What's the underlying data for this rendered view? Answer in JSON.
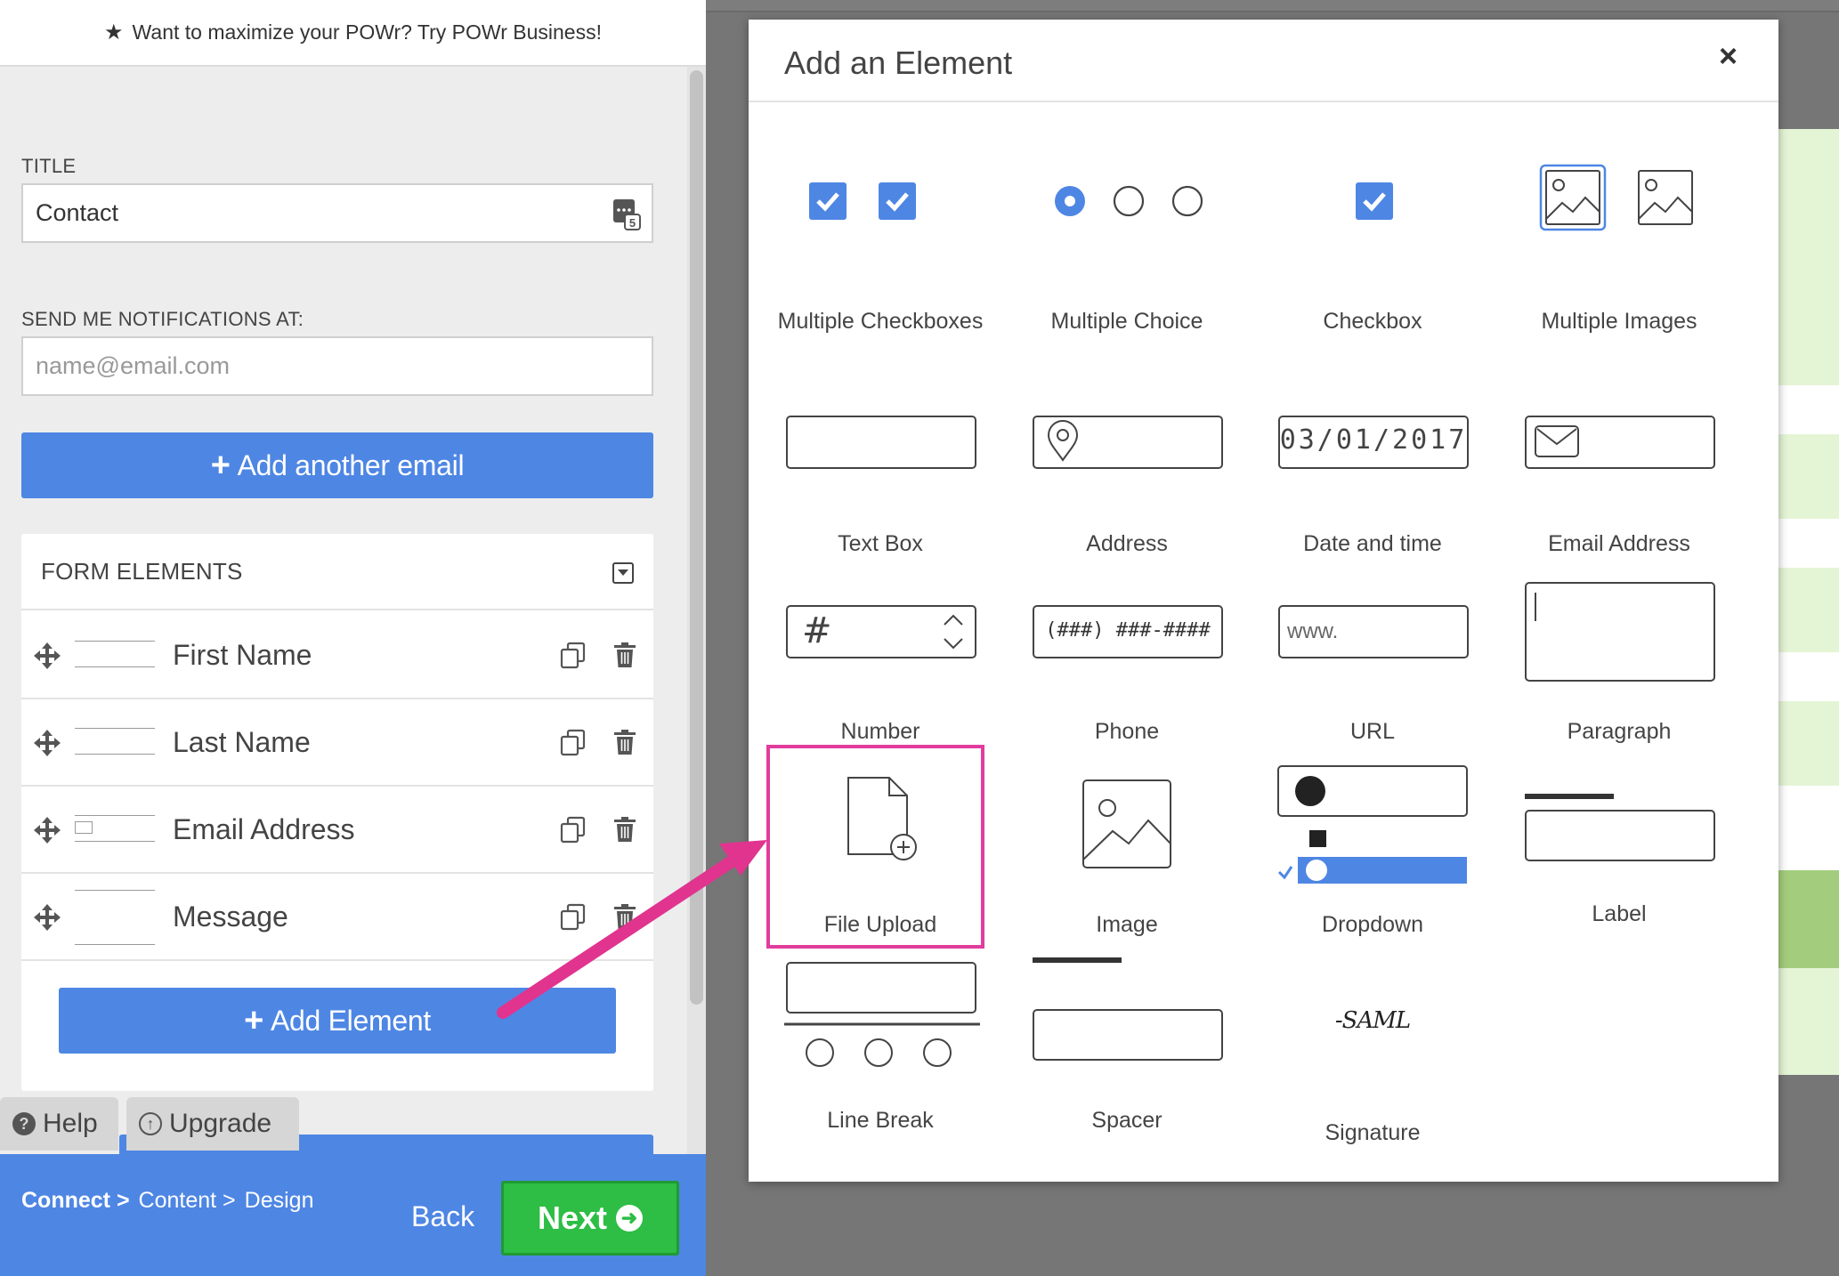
{
  "promo": {
    "text": "Want to maximize your POWr? Try POWr Business!",
    "icon": "star-icon"
  },
  "settings": {
    "title_label": "TITLE",
    "title_value": "Contact",
    "notify_label": "SEND ME NOTIFICATIONS AT:",
    "notify_placeholder": "name@email.com",
    "add_email_label": "Add another email"
  },
  "form_elements": {
    "header": "FORM ELEMENTS",
    "rows": [
      {
        "name": "First Name"
      },
      {
        "name": "Last Name"
      },
      {
        "name": "Email Address"
      },
      {
        "name": "Message"
      }
    ],
    "add_element_label": "Add Element"
  },
  "tabs": {
    "help": "Help",
    "upgrade": "Upgrade"
  },
  "footer": {
    "crumbs": [
      "Connect >",
      "Content >",
      "Design"
    ],
    "back_label": "Back",
    "next_label": "Next"
  },
  "modal": {
    "title": "Add an Element",
    "close": "×",
    "elements": [
      {
        "label": "Multiple Checkboxes"
      },
      {
        "label": "Multiple Choice"
      },
      {
        "label": "Checkbox"
      },
      {
        "label": "Multiple Images"
      },
      {
        "label": "Text Box"
      },
      {
        "label": "Address"
      },
      {
        "label": "Date and time",
        "sample": "03/01/2017"
      },
      {
        "label": "Email Address"
      },
      {
        "label": "Number",
        "sample": "#"
      },
      {
        "label": "Phone",
        "sample": "(###) ###-####"
      },
      {
        "label": "URL",
        "sample": "www."
      },
      {
        "label": "Paragraph"
      },
      {
        "label": "File Upload"
      },
      {
        "label": "Image"
      },
      {
        "label": "Dropdown"
      },
      {
        "label": "Label"
      },
      {
        "label": "Line Break"
      },
      {
        "label": "Spacer"
      },
      {
        "label": "Signature",
        "sample": "-SAML"
      }
    ]
  },
  "colors": {
    "accent": "#4e86e4",
    "next_green": "#2ebd45",
    "highlight": "#e23c9e",
    "arrow": "#e0348f"
  }
}
